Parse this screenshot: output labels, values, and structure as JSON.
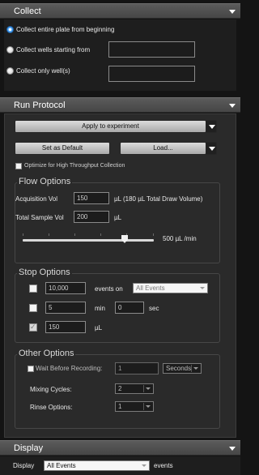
{
  "collect": {
    "title": "Collect",
    "options": [
      {
        "label": "Collect entire plate from beginning",
        "selected": true
      },
      {
        "label": "Collect wells starting from",
        "selected": false,
        "value": ""
      },
      {
        "label": "Collect only well(s)",
        "selected": false,
        "value": ""
      }
    ]
  },
  "run_protocol": {
    "title": "Run Protocol",
    "apply_label": "Apply to experiment",
    "set_default_label": "Set as Default",
    "load_label": "Load...",
    "optimize_label": "Optimize for High Throughput Collection",
    "optimize_checked": false
  },
  "flow_options": {
    "title": "Flow Options",
    "acq_vol_label": "Acquisition Vol",
    "acq_vol_value": "150",
    "acq_vol_suffix": "µL (180 µL Total Draw Volume)",
    "total_vol_label": "Total Sample Vol",
    "total_vol_value": "200",
    "total_vol_unit": "µL",
    "flow_rate_label": "500 µL /min",
    "flow_rate_fraction": 0.78
  },
  "stop_options": {
    "title": "Stop Options",
    "events_value": "10,000",
    "events_on_label": "events on",
    "events_select": "All Events",
    "min_value": "5",
    "min_label": "min",
    "sec_value": "0",
    "sec_label": "sec",
    "vol_value": "150",
    "vol_label": "µL",
    "vol_checked": true
  },
  "other_options": {
    "title": "Other Options",
    "wait_label": "Wait Before Recording:",
    "wait_value": "1",
    "wait_unit": "Seconds",
    "mixing_label": "Mixing Cycles:",
    "mixing_value": "2",
    "rinse_label": "Rinse Options:",
    "rinse_value": "1"
  },
  "display": {
    "title": "Display",
    "label": "Display",
    "select_value": "All Events",
    "suffix": "events"
  },
  "colors": {
    "background": "#141414",
    "panel": "#2a2a2a",
    "header": "#4f4f4f",
    "radio_selected": "#2a7ed0"
  }
}
